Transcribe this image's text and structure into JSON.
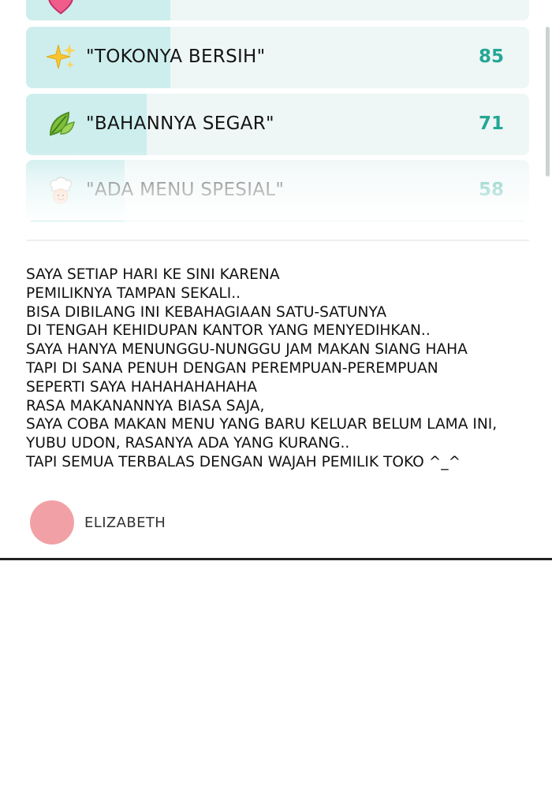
{
  "stats": [
    {
      "icon": "heart-icon",
      "glyph": "♥",
      "label": "",
      "count": "",
      "share": null
    },
    {
      "icon": "sparkles-icon",
      "glyph": "✨",
      "label": "\"TOKONYA BERSIH\"",
      "count": "85",
      "share": 0.29
    },
    {
      "icon": "leaf-icon",
      "glyph": "🍃",
      "label": "\"BAHANNYA SEGAR\"",
      "count": "71",
      "share": 0.24
    },
    {
      "icon": "chef-icon",
      "glyph": "👨‍🍳",
      "label": "\"ADA MENU SPESIAL\"",
      "count": "58",
      "share": 0.2
    }
  ],
  "review": {
    "lines": [
      "SAYA SETIAP HARI KE SINI KARENA",
      "PEMILIKNYA TAMPAN SEKALI..",
      "BISA DIBILANG INI KEBAHAGIAAN SATU-SATUNYA",
      "DI TENGAH KEHIDUPAN KANTOR YANG MENYEDIHKAN..",
      "SAYA HANYA MENUNGGU-NUNGGU JAM MAKAN SIANG HAHA",
      "TAPI DI SANA PENUH DENGAN PEREMPUAN-PEREMPUAN",
      "SEPERTI SAYA HAHAHAHAHAHA",
      "RASA MAKANANNYA BIASA SAJA,",
      "SAYA COBA MAKAN MENU YANG BARU KELUAR BELUM LAMA INI,",
      "YUBU UDON, RASANYA ADA YANG KURANG..",
      "TAPI SEMUA TERBALAS DENGAN WAJAH PEMILIK TOKO ^_^"
    ]
  },
  "author": {
    "name": "ELIZABETH",
    "avatar_color": "#f1a1a5"
  },
  "colors": {
    "count": "#23a795",
    "row_background": "#eef6f6",
    "row_fill": "#cdeeed"
  }
}
